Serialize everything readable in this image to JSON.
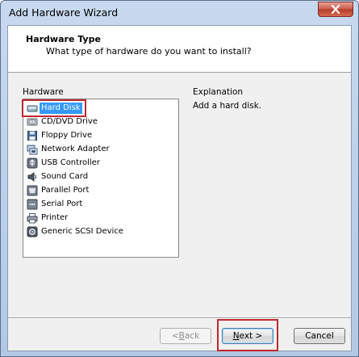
{
  "window": {
    "title": "Add Hardware Wizard"
  },
  "header": {
    "title": "Hardware Type",
    "subtitle": "What type of hardware do you want to install?"
  },
  "hardware": {
    "label": "Hardware",
    "items": [
      {
        "label": "Hard Disk",
        "icon": "hard-disk-icon",
        "selected": true
      },
      {
        "label": "CD/DVD Drive",
        "icon": "cd-dvd-icon"
      },
      {
        "label": "Floppy Drive",
        "icon": "floppy-icon"
      },
      {
        "label": "Network Adapter",
        "icon": "network-adapter-icon"
      },
      {
        "label": "USB Controller",
        "icon": "usb-icon"
      },
      {
        "label": "Sound Card",
        "icon": "sound-card-icon"
      },
      {
        "label": "Parallel Port",
        "icon": "parallel-port-icon"
      },
      {
        "label": "Serial Port",
        "icon": "serial-port-icon"
      },
      {
        "label": "Printer",
        "icon": "printer-icon"
      },
      {
        "label": "Generic SCSI Device",
        "icon": "scsi-icon"
      }
    ]
  },
  "explanation": {
    "label": "Explanation",
    "text": "Add a hard disk."
  },
  "buttons": {
    "back_prefix": "< ",
    "back_key": "B",
    "back_rest": "ack",
    "next_key": "N",
    "next_rest": "ext >",
    "cancel": "Cancel"
  },
  "colors": {
    "selection": "#3399ff",
    "highlight_box": "#c0282d",
    "close_button": "#c75a48"
  }
}
